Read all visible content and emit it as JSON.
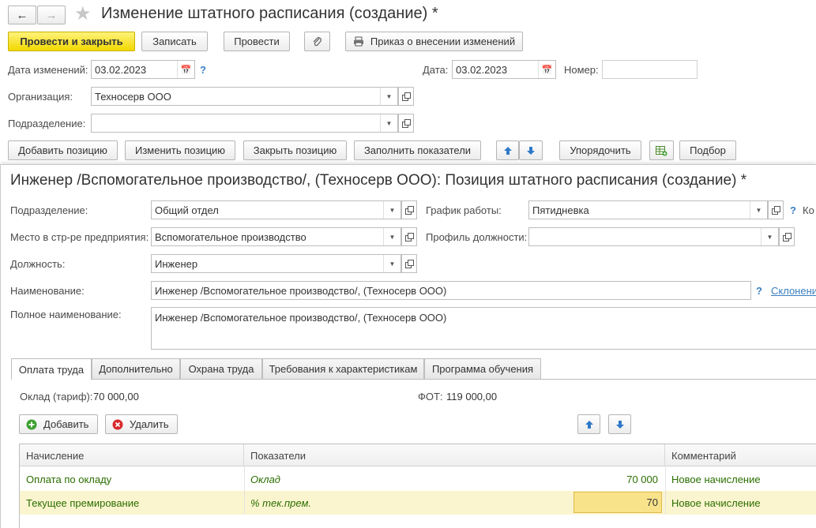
{
  "window": {
    "title": "Изменение штатного расписания (создание) *"
  },
  "toolbar": {
    "post_close": "Провести и закрыть",
    "write": "Записать",
    "post": "Провести",
    "order": "Приказ о внесении изменений"
  },
  "header": {
    "change_date_label": "Дата изменений:",
    "change_date_value": "03.02.2023",
    "date_label": "Дата:",
    "date_value": "03.02.2023",
    "number_label": "Номер:",
    "number_value": "",
    "org_label": "Организация:",
    "org_value": "Техносерв ООО",
    "dept_label": "Подразделение:",
    "dept_value": ""
  },
  "actions": {
    "add_position": "Добавить позицию",
    "change_position": "Изменить позицию",
    "close_position": "Закрыть позицию",
    "fill_indicators": "Заполнить показатели",
    "order": "Упорядочить",
    "select": "Подбор"
  },
  "position": {
    "title": "Инженер /Вспомогательное производство/, (Техносерв ООО): Позиция штатного расписания (создание) *",
    "dept_label": "Подразделение:",
    "dept_value": "Общий отдел",
    "schedule_label": "График работы:",
    "schedule_value": "Пятидневка",
    "schedule_extra": "Ко",
    "place_label": "Место в стр-ре предприятия:",
    "place_value": "Вспомогательное производство",
    "profile_label": "Профиль должности:",
    "profile_value": "",
    "job_label": "Должность:",
    "job_value": "Инженер",
    "name_label": "Наименование:",
    "name_value": "Инженер /Вспомогательное производство/, (Техносерв ООО)",
    "declension_link": "Склонени",
    "fullname_label": "Полное наименование:",
    "fullname_value": "Инженер /Вспомогательное производство/, (Техносерв ООО)"
  },
  "tabs": [
    {
      "label": "Оплата труда"
    },
    {
      "label": "Дополнительно"
    },
    {
      "label": "Охрана труда"
    },
    {
      "label": "Требования к характеристикам"
    },
    {
      "label": "Программа обучения"
    }
  ],
  "pay": {
    "salary_label": "Оклад (тариф):",
    "salary_value": "70 000,00",
    "fot_label": "ФОТ:",
    "fot_value": "119 000,00",
    "add": "Добавить",
    "delete": "Удалить"
  },
  "table": {
    "columns": [
      "Начисление",
      "Показатели",
      "Комментарий"
    ],
    "rows": [
      {
        "accrual": "Оплата по окладу",
        "indicator": "Оклад",
        "value": "70 000",
        "comment": "Новое начисление"
      },
      {
        "accrual": "Текущее премирование",
        "indicator": "% тек.прем.",
        "value": "70",
        "comment": "Новое начисление"
      }
    ]
  },
  "colors": {
    "primary_button": "#f2d800",
    "selected_row": "#fbf5cf",
    "edit_cell": "#f9e38a",
    "accent_text": "#2b6e00",
    "link": "#3a7fc1"
  }
}
